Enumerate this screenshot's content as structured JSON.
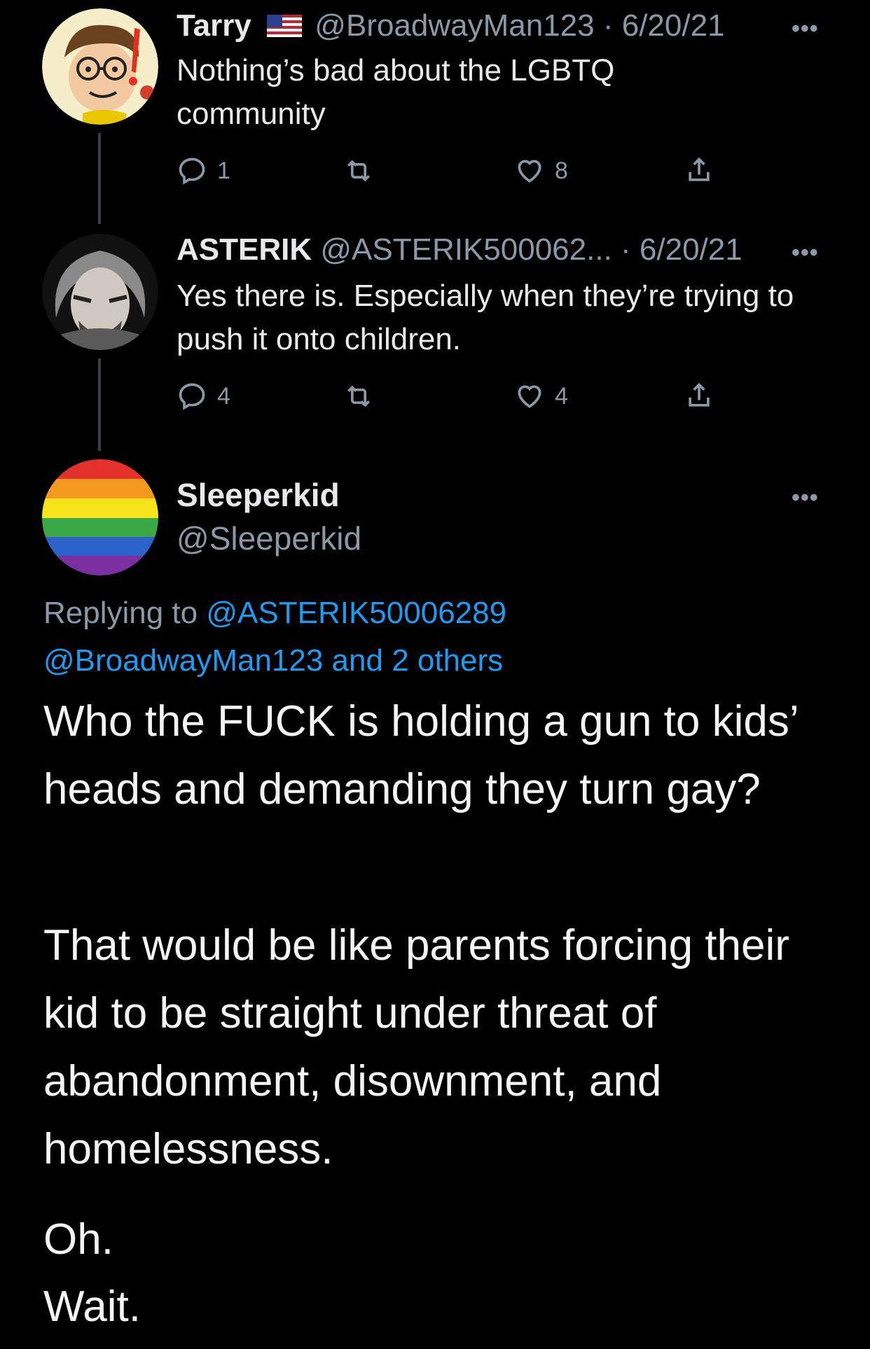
{
  "tweets": [
    {
      "name": "Tarry",
      "flag": "🇺🇸",
      "handle": "@BroadwayMan123",
      "date": "· 6/20/21",
      "text": "Nothing’s bad about the LGBTQ community",
      "replies": "1",
      "likes": "8"
    },
    {
      "name": "ASTERIK",
      "handle": "@ASTERIK500062...",
      "date": "· 6/20/21",
      "text": "Yes there is. Especially when they’re trying to push it onto children.",
      "replies": "4",
      "likes": "4"
    }
  ],
  "main_tweet": {
    "name": "Sleeperkid",
    "handle": "@Sleeperkid",
    "replying_prefix": "Replying to",
    "replying_user": "@ASTERIK50006289",
    "replying_line2": "@BroadwayMan123 and 2 others",
    "paragraphs": [
      "Who the FUCK is holding a gun to kids’ heads and demanding they turn gay?",
      "That would be like parents forcing their kid to be straight under threat of abandonment, disownment, and homelessness.",
      "Oh.",
      "Wait."
    ]
  },
  "more_label": "•••",
  "colors": {
    "background": "#000000",
    "text": "#e7e9ea",
    "muted": "#8b98a5",
    "link": "#1d9bf0",
    "rainbow": [
      "#e4312b",
      "#f39a1e",
      "#f7e31a",
      "#3aa845",
      "#2a62c9",
      "#7b2fa0"
    ]
  },
  "icons": [
    "reply-icon",
    "retweet-icon",
    "like-icon",
    "share-icon",
    "more-icon",
    "us-flag-icon"
  ]
}
